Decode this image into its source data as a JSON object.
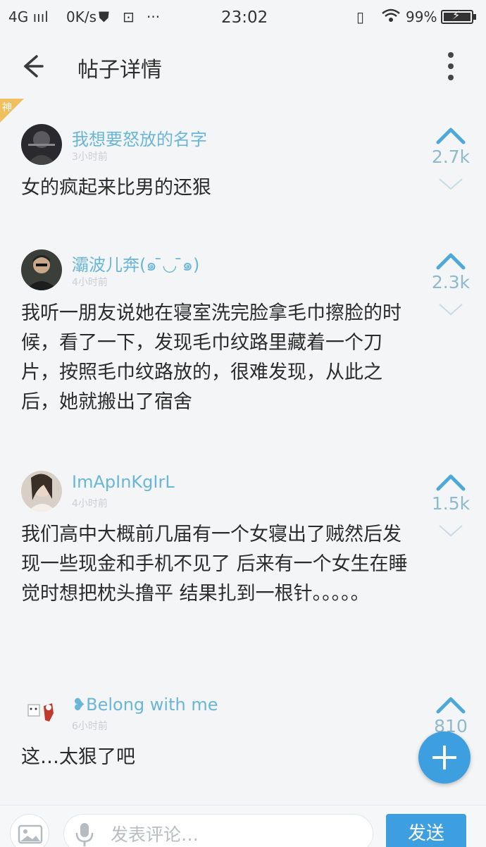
{
  "status_bar": {
    "signal": "4G ıııl",
    "speed": "0K/s",
    "time": "23:02",
    "battery": "99%"
  },
  "header": {
    "title": "帖子详情"
  },
  "god_badge": "神",
  "comments": [
    {
      "username": "我想要怒放的名字",
      "time": "3小时前",
      "text": "女的疯起来比男的还狠",
      "count": "2.7k"
    },
    {
      "username": "灞波儿奔(๑ ̄◡ ̄๑)",
      "time": "4小时前",
      "text": "我听一朋友说她在寝室洗完脸拿毛巾擦脸的时候，看了一下，发现毛巾纹路里藏着一个刀片，按照毛巾纹路放的，很难发现，从此之后，她就搬出了宿舍",
      "count": "2.3k"
    },
    {
      "username": "ImApInKgIrL",
      "time": "4小时前",
      "text": "我们高中大概前几届有一个女寝出了贼然后发现一些现金和手机不见了 后来有一个女生在睡觉时想把枕头撸平 结果扎到一根针。。。。。",
      "count": "1.5k"
    },
    {
      "username": "❥Belong with me",
      "time": "6小时前",
      "text": "这…太狠了吧",
      "count": "810"
    }
  ],
  "bottom_bar": {
    "placeholder": "发表评论…",
    "send_label": "发送"
  },
  "colors": {
    "accent": "#3e9fe0",
    "username": "#6ab6d8",
    "vote": "#8fb9cc"
  }
}
